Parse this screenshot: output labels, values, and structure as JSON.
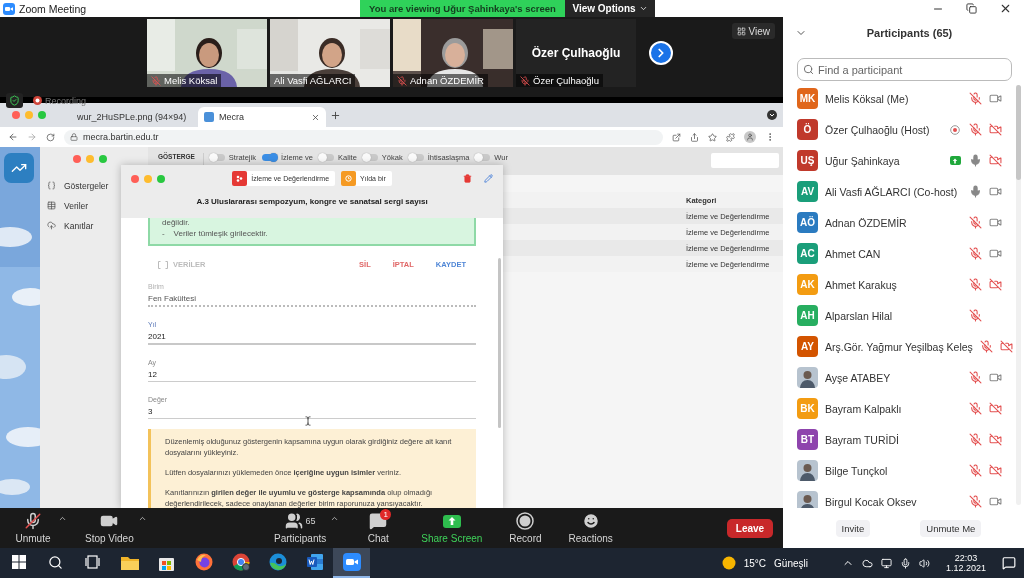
{
  "window": {
    "title": "Zoom Meeting"
  },
  "share_banner": {
    "text": "You are viewing Uğur Şahinkaya's screen",
    "view_options": "View Options"
  },
  "video_strip": {
    "tiles": [
      {
        "label": "Melis Köksal",
        "muted": true,
        "video": true
      },
      {
        "label": "Ali Vasfi AĞLARCI",
        "muted": false,
        "video": true
      },
      {
        "label": "Adnan ÖZDEMİR",
        "muted": true,
        "video": true
      },
      {
        "name": "Özer Çulhaoğlu",
        "label": "Özer Çulhaoğlu",
        "muted": true,
        "video": false
      }
    ],
    "view_button": "View"
  },
  "shared_screen": {
    "recording": "Recording",
    "browser": {
      "tabs": [
        {
          "title": "wur_2HuSPLe.png (94×94)",
          "selected": false
        },
        {
          "title": "Mecra",
          "kind": "app",
          "selected": true
        }
      ],
      "address": "mecra.bartin.edu.tr"
    },
    "app": {
      "sidebar": [
        {
          "label": "Göstergeler",
          "kind": "braces"
        },
        {
          "label": "Veriler",
          "kind": "table"
        },
        {
          "label": "Kanıtlar",
          "kind": "cloud"
        }
      ],
      "header_title": "GÖSTERGE",
      "filters": [
        {
          "label": "Stratejik",
          "on": false
        },
        {
          "label": "İzleme ve",
          "on": true
        },
        {
          "label": "Kalite",
          "on": false
        },
        {
          "label": "Yökak",
          "on": false
        },
        {
          "label": "İhtisaslaşma",
          "on": false
        },
        {
          "label": "Wur",
          "on": false
        }
      ],
      "table": {
        "column": "Kategori",
        "rows": [
          "İzleme ve Değerlendirme",
          "İzleme ve Değerlendirme",
          "İzleme ve Değerlendirme",
          "İzleme ve Değerlendirme"
        ]
      },
      "modal": {
        "chips": [
          {
            "label": "İzleme ve Değerlendirme",
            "color": "#e53935",
            "kind": "category"
          },
          {
            "label": "Yılda bir",
            "color": "#f59a23",
            "kind": "period"
          }
        ],
        "title": "A.3 Uluslararası sempozyum, kongre ve sanatsal sergi sayısı",
        "notice_lines": [
          "değildir.",
          "-    Veriler tümleşik girilecektir."
        ],
        "tab": "VERİLER",
        "actions": [
          {
            "label": "SİL",
            "kind": "danger"
          },
          {
            "label": "İPTAL",
            "kind": "danger"
          },
          {
            "label": "KAYDET",
            "kind": "primary"
          }
        ],
        "fields": [
          {
            "label": "Birim",
            "value": "Fen Fakültesi",
            "focused": false,
            "disabled": true
          },
          {
            "label": "Yıl",
            "value": "2021",
            "focused": true,
            "disabled": false
          },
          {
            "label": "Ay",
            "value": "12",
            "focused": false,
            "disabled": false
          },
          {
            "label": "Değer",
            "value": "3",
            "focused": false,
            "disabled": false
          }
        ],
        "hint": [
          "Düzenlemiş olduğunuz göstergenin kapsamına uygun olarak girdiğiniz değere ait kanıt dosyalarını yükleyiniz.",
          "Lütfen dosyalarınızı yüklemeden önce **içeriğine uygun isimler** veriniz.",
          "Kanıtlarınızın **girilen değer ile uyumlu ve gösterge kapsamında** olup olmadığı değerlendirilecek, sadece onaylanan değerler birim raporunuza yansıyacaktır."
        ]
      }
    }
  },
  "toolbar": {
    "items": [
      {
        "kind": "mic_off",
        "label": "Unmute",
        "menu": true
      },
      {
        "kind": "video",
        "label": "Stop Video",
        "menu": true
      },
      {
        "kind": "participants",
        "label": "Participants",
        "count": "65",
        "menu": true
      },
      {
        "kind": "chat",
        "label": "Chat",
        "badge": "1",
        "menu": false
      },
      {
        "kind": "share",
        "label": "Share Screen",
        "menu": false
      },
      {
        "kind": "record",
        "label": "Record",
        "menu": false
      },
      {
        "kind": "reactions",
        "label": "Reactions",
        "menu": false
      }
    ],
    "leave": "Leave"
  },
  "participants": {
    "title": "Participants (65)",
    "search_placeholder": "Find a participant",
    "list": [
      {
        "name": "Melis Köksal (Me)",
        "avatar": {
          "kind": "initials",
          "initials": "MK",
          "color": "#e0661b"
        },
        "muted": true,
        "show_video": true,
        "video_off": false,
        "recording": false,
        "sharing": false
      },
      {
        "name": "Özer Çulhaoğlu (Host)",
        "avatar": {
          "kind": "initials",
          "initials": "Ö",
          "color": "#c0392b"
        },
        "muted": true,
        "show_video": true,
        "video_off": true,
        "recording": true,
        "sharing": false
      },
      {
        "name": "Uğur Şahinkaya",
        "avatar": {
          "kind": "initials",
          "initials": "UŞ",
          "color": "#c0392b"
        },
        "muted": false,
        "show_video": true,
        "video_off": true,
        "recording": false,
        "sharing": true
      },
      {
        "name": "Ali Vasfi AĞLARCI (Co-host)",
        "avatar": {
          "kind": "initials",
          "initials": "AV",
          "color": "#1a9e7a"
        },
        "muted": false,
        "show_video": true,
        "video_off": false,
        "recording": false,
        "sharing": false
      },
      {
        "name": "Adnan ÖZDEMİR",
        "avatar": {
          "kind": "initials",
          "initials": "AÖ",
          "color": "#2b7bc0"
        },
        "muted": true,
        "show_video": true,
        "video_off": false,
        "recording": false,
        "sharing": false
      },
      {
        "name": "Ahmet CAN",
        "avatar": {
          "kind": "initials",
          "initials": "AC",
          "color": "#1a9e7a"
        },
        "muted": true,
        "show_video": true,
        "video_off": false,
        "recording": false,
        "sharing": false
      },
      {
        "name": "Ahmet Karakuş",
        "avatar": {
          "kind": "initials",
          "initials": "AK",
          "color": "#f39c12"
        },
        "muted": true,
        "show_video": true,
        "video_off": true,
        "recording": false,
        "sharing": false
      },
      {
        "name": "Alparslan Hilal",
        "avatar": {
          "kind": "initials",
          "initials": "AH",
          "color": "#27ae60"
        },
        "muted": true,
        "show_video": false,
        "recording": false,
        "sharing": false
      },
      {
        "name": "Arş.Gör. Yağmur Yeşilbaş Keleş",
        "avatar": {
          "kind": "initials",
          "initials": "AY",
          "color": "#d35400"
        },
        "muted": true,
        "show_video": true,
        "video_off": true,
        "recording": false,
        "sharing": false
      },
      {
        "name": "Ayşe ATABEY",
        "muted": true,
        "show_video": true,
        "video_off": false,
        "recording": false,
        "sharing": false
      },
      {
        "name": "Bayram Kalpaklı",
        "avatar": {
          "kind": "initials",
          "initials": "BK",
          "color": "#f39c12"
        },
        "muted": true,
        "show_video": true,
        "video_off": true,
        "recording": false,
        "sharing": false
      },
      {
        "name": "Bayram TURİDİ",
        "avatar": {
          "kind": "initials",
          "initials": "BT",
          "color": "#8e44ad"
        },
        "muted": true,
        "show_video": true,
        "video_off": true,
        "recording": false,
        "sharing": false
      },
      {
        "name": "Bilge Tunçkol",
        "muted": true,
        "show_video": true,
        "video_off": true,
        "recording": false,
        "sharing": false
      },
      {
        "name": "Birgul Kocak Oksev",
        "muted": true,
        "show_video": true,
        "video_off": false,
        "recording": false,
        "sharing": false
      }
    ],
    "buttons": [
      "Invite",
      "Unmute Me"
    ]
  },
  "taskbar": {
    "apps": [
      {
        "kind": "start",
        "selected": false
      },
      {
        "kind": "search",
        "selected": false
      },
      {
        "kind": "taskview",
        "selected": false
      },
      {
        "kind": "folder",
        "selected": false
      },
      {
        "kind": "store",
        "selected": false
      },
      {
        "kind": "firefox",
        "selected": false
      },
      {
        "kind": "chrome",
        "selected": false
      },
      {
        "kind": "edge",
        "selected": false
      },
      {
        "kind": "word",
        "selected": false
      },
      {
        "kind": "zoom",
        "selected": true
      }
    ],
    "weather": "15°C",
    "condition": "Güneşli",
    "time": "22:03",
    "date": "1.12.2021"
  }
}
